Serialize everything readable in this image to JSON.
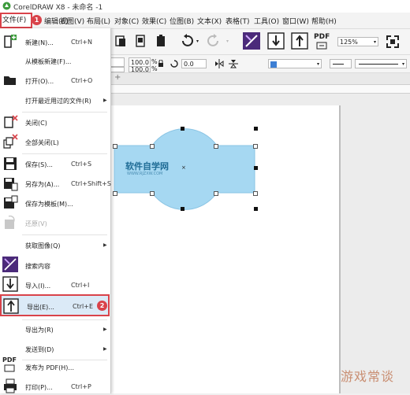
{
  "window": {
    "title": "CorelDRAW X8 - 未命名 -1"
  },
  "menubar": {
    "items": [
      "文件(F)",
      "编辑(E)",
      "视图(V)",
      "布局(L)",
      "对象(C)",
      "效果(C)",
      "位图(B)",
      "文本(X)",
      "表格(T)",
      "工具(O)",
      "窗口(W)",
      "帮助(H)"
    ],
    "file_step": "1"
  },
  "toolbar": {
    "zoom_value": "125%",
    "scale_x": "100.0",
    "scale_y": "100.0",
    "percent_x": "%",
    "percent_y": "%",
    "angle_value": "0.0",
    "pdf_label": "PDF"
  },
  "file_menu": {
    "items": [
      {
        "label": "新建(N)...",
        "shortcut": "Ctrl+N",
        "icon": "new-document-icon"
      },
      {
        "label": "从模板新建(F)...",
        "shortcut": "",
        "icon": ""
      },
      {
        "label": "打开(O)...",
        "shortcut": "Ctrl+O",
        "icon": "open-folder-icon"
      },
      {
        "label": "打开最近用过的文件(R)",
        "shortcut": "",
        "icon": "",
        "submenu": true
      },
      {
        "label": "关闭(C)",
        "shortcut": "",
        "icon": "close-document-icon"
      },
      {
        "label": "全部关闭(L)",
        "shortcut": "",
        "icon": "close-all-icon"
      },
      {
        "label": "保存(S)...",
        "shortcut": "Ctrl+S",
        "icon": "save-icon"
      },
      {
        "label": "另存为(A)...",
        "shortcut": "Ctrl+Shift+S",
        "icon": "save-as-icon"
      },
      {
        "label": "保存为模板(M)...",
        "shortcut": "",
        "icon": "save-template-icon"
      },
      {
        "label": "还原(V)",
        "shortcut": "",
        "icon": "revert-icon",
        "disabled": true
      },
      {
        "label": "获取图像(Q)",
        "shortcut": "",
        "icon": "",
        "submenu": true
      },
      {
        "label": "搜索内容",
        "shortcut": "",
        "icon": "search-content-icon"
      },
      {
        "label": "导入(I)...",
        "shortcut": "Ctrl+I",
        "icon": "import-icon"
      },
      {
        "label": "导出(E)...",
        "shortcut": "Ctrl+E",
        "icon": "export-icon",
        "step": "2"
      },
      {
        "label": "导出为(R)",
        "shortcut": "",
        "icon": "",
        "submenu": true
      },
      {
        "label": "发送到(D)",
        "shortcut": "",
        "icon": "",
        "submenu": true
      },
      {
        "label": "发布为 PDF(H)...",
        "shortcut": "",
        "icon": "publish-pdf-icon"
      },
      {
        "label": "打印(P)...",
        "shortcut": "Ctrl+P",
        "icon": "print-icon"
      }
    ]
  },
  "canvas": {
    "shape_text": "软件自学网",
    "shape_subtext": "WWW.RJZXW.COM",
    "shape_color": "#a6d8f2"
  },
  "watermark": "游戏常谈",
  "colors": {
    "accent_red": "#d9434a",
    "highlight": "#dbeaf7",
    "purple_icon": "#4b2a7a"
  }
}
